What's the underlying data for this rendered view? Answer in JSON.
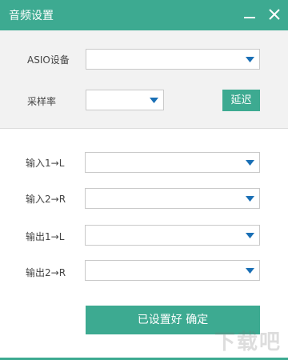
{
  "window": {
    "title": "音频设置",
    "controls": {
      "minimize_icon": "minimize-icon",
      "close_icon": "close-icon"
    }
  },
  "device": {
    "asio_label": "ASIO设备",
    "asio_value": "",
    "sample_rate_label": "采样率",
    "sample_rate_value": "",
    "latency_button": "延迟"
  },
  "channels": [
    {
      "label": "输入1→L",
      "value": ""
    },
    {
      "label": "输入2→R",
      "value": ""
    },
    {
      "label": "输出1→L",
      "value": ""
    },
    {
      "label": "输出2→R",
      "value": ""
    }
  ],
  "confirm_button": "已设置好 确定",
  "watermark": "下载吧",
  "colors": {
    "accent": "#3daa91",
    "arrow": "#1a6fb5"
  }
}
